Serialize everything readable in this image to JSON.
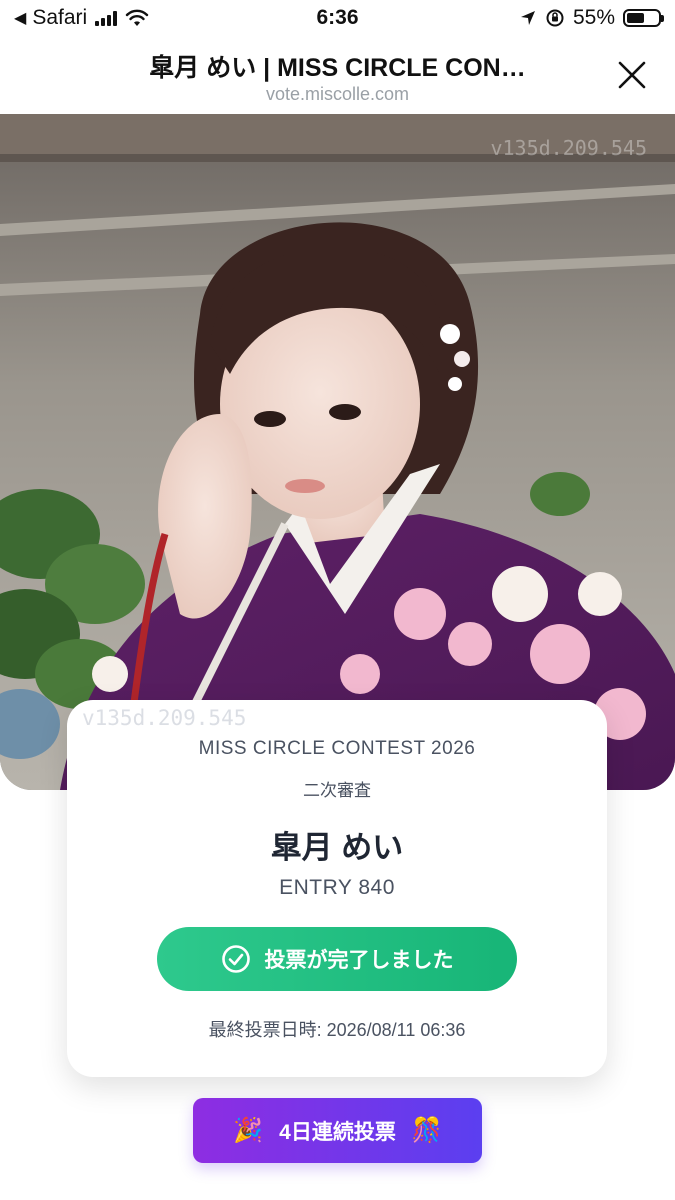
{
  "status_bar": {
    "back_app": "Safari",
    "time": "6:36",
    "battery_percent": "55%",
    "battery_level": 0.55
  },
  "browser": {
    "title": "皐月 めい | MISS CIRCLE CON…",
    "url": "vote.miscolle.com"
  },
  "hero": {
    "watermark_top": "v135d.209.545"
  },
  "card": {
    "watermark": "v135d.209.545",
    "contest_name": "MISS CIRCLE CONTEST 2026",
    "stage": "二次審査",
    "entrant_name": "皐月 めい",
    "entry_number": "ENTRY 840",
    "vote_button_label": "投票が完了しました",
    "last_vote_label": "最終投票日時: 2026/08/11 06:36"
  },
  "streak": {
    "label": "4日連続投票",
    "left_emoji": "🎉",
    "right_emoji": "🎊"
  },
  "colors": {
    "vote_green": "#22c07f",
    "streak_purple": "#7b33e8",
    "kimono_purple": "#5a1f63"
  }
}
